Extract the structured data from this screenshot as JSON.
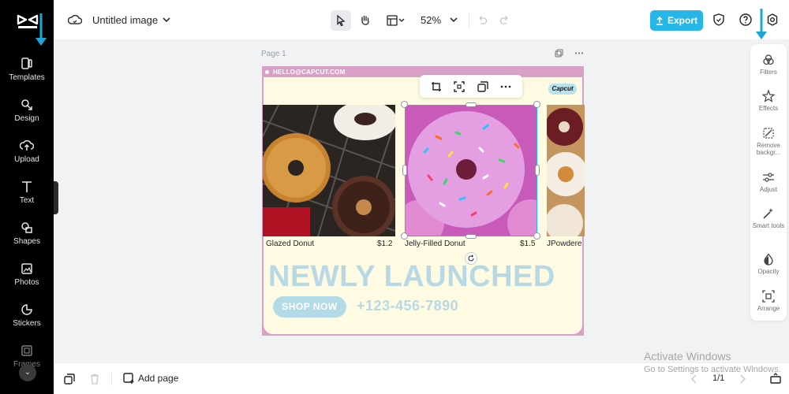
{
  "app": {
    "title": "Untitled image",
    "zoom": "52%"
  },
  "left_rail": {
    "items": [
      {
        "label": "Templates",
        "icon": "templates-icon"
      },
      {
        "label": "Design",
        "icon": "design-icon"
      },
      {
        "label": "Upload",
        "icon": "upload-icon"
      },
      {
        "label": "Text",
        "icon": "text-icon"
      },
      {
        "label": "Shapes",
        "icon": "shapes-icon"
      },
      {
        "label": "Photos",
        "icon": "photos-icon"
      },
      {
        "label": "Stickers",
        "icon": "stickers-icon"
      },
      {
        "label": "Frames",
        "icon": "frames-icon"
      }
    ]
  },
  "toolbar": {
    "export_label": "Export"
  },
  "right_panel": {
    "items": [
      {
        "label": "Filters",
        "icon": "filters-icon"
      },
      {
        "label": "Effects",
        "icon": "effects-icon"
      },
      {
        "label": "Remove backgr...",
        "icon": "remove-background-icon"
      },
      {
        "label": "Adjust",
        "icon": "adjust-icon"
      },
      {
        "label": "Smart tools",
        "icon": "smart-tools-icon"
      },
      {
        "label": "Opacity",
        "icon": "opacity-icon"
      },
      {
        "label": "Arrange",
        "icon": "arrange-icon"
      }
    ]
  },
  "canvas": {
    "page_label": "Page 1",
    "email": "HELLO@CAPCUT.COM",
    "brand": "Capcut",
    "products": [
      {
        "name": "Glazed Donut",
        "price": "$1.2"
      },
      {
        "name": "Jelly-Filled Donut",
        "price": "$1.5"
      },
      {
        "name": "JPowdere",
        "price": ""
      }
    ],
    "headline": "NEWLY LAUNCHED",
    "cta": "SHOP NOW",
    "phone": "+123-456-7890"
  },
  "bottom_bar": {
    "add_page_label": "Add page",
    "page_counter": "1/1"
  },
  "watermark": {
    "line1": "Activate Windows",
    "line2": "Go to Settings to activate Windows."
  },
  "colors": {
    "accent": "#26b6e8",
    "rail_bg": "#000000",
    "design_frame": "#d9a1c7",
    "design_bg": "#fefbe2",
    "headline": "#b8d8e4"
  }
}
